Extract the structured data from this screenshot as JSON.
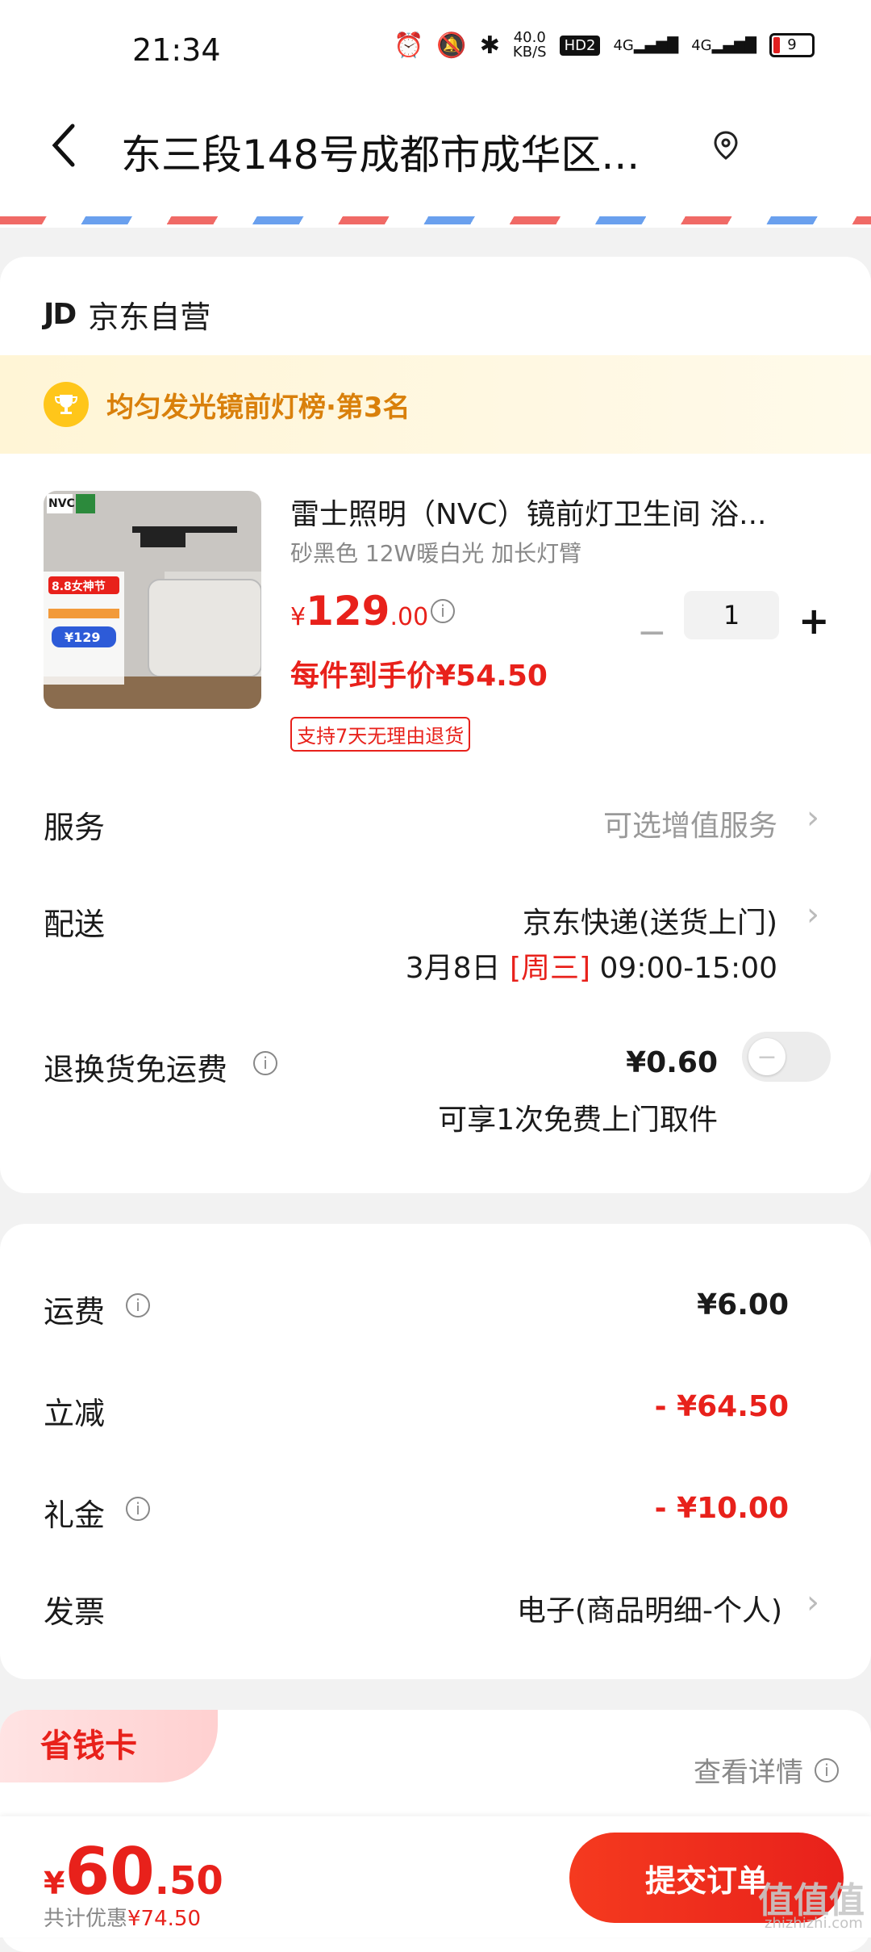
{
  "status_bar": {
    "time": "21:34",
    "net_speed_value": "40.0",
    "net_speed_unit": "KB/S",
    "hd_badge": "HD2",
    "signal1": "4G",
    "signal2": "4G",
    "battery": "9"
  },
  "header": {
    "address": "东三段148号成都市成华区..."
  },
  "shop": {
    "logo": "JD",
    "name": "京东自营"
  },
  "rank_banner": {
    "text": "均匀发光镜前灯榜·第3名"
  },
  "product": {
    "name": "雷士照明（NVC）镜前灯卫生间 浴...",
    "spec": "砂黑色 12W暖白光 加长灯臂",
    "price_currency": "¥",
    "price_integer": "129",
    "price_decimal": ".00",
    "quantity": "1",
    "unit_price_label": "每件到手价¥54.50",
    "return_badge": "支持7天无理由退货",
    "thumb": {
      "brand": "NVC",
      "promo": "8.8女神节",
      "price_tag": "¥129"
    }
  },
  "service": {
    "label": "服务",
    "value": "可选增值服务"
  },
  "delivery": {
    "label": "配送",
    "method": "京东快递(送货上门)",
    "date": "3月8日",
    "weekday": "[周三]",
    "time_window": "09:00-15:00"
  },
  "return_shipping": {
    "label": "退换货免运费",
    "price": "¥0.60",
    "note": "可享1次免费上门取件",
    "enabled": false
  },
  "summary": {
    "shipping_label": "运费",
    "shipping_value": "¥6.00",
    "discount_label": "立减",
    "discount_value": "- ¥64.50",
    "gift_label": "礼金",
    "gift_value": "- ¥10.00",
    "invoice_label": "发票",
    "invoice_value": "电子(商品明细-个人)"
  },
  "saving_card": {
    "title": "省钱卡",
    "detail": "查看详情"
  },
  "bottom_bar": {
    "currency": "¥",
    "total_integer": "60",
    "total_decimal": ".50",
    "saved_prefix": "共计优惠",
    "saved_value": "¥74.50",
    "submit_label": "提交订单"
  },
  "watermark": {
    "text": "值值值",
    "subtext": "zhizhizhi.com"
  },
  "colors": {
    "accent_red": "#e8211b",
    "rank_gold": "#d9800b",
    "background": "#f2f2f2"
  }
}
